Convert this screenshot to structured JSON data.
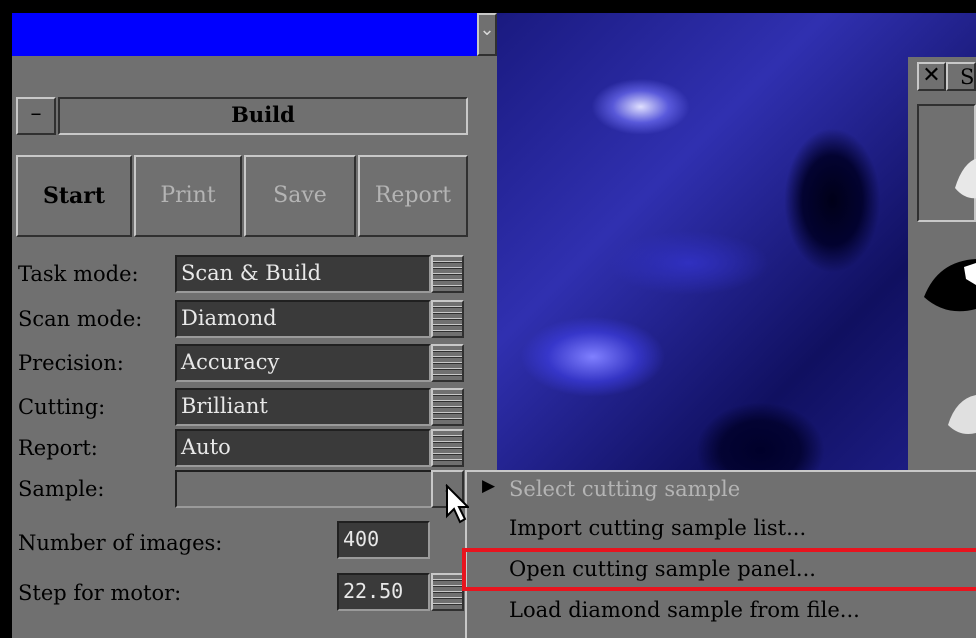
{
  "panel": {
    "section_title": "Build",
    "collapse_label": "–",
    "toolbar": [
      {
        "label": "Start",
        "enabled": true
      },
      {
        "label": "Print",
        "enabled": false
      },
      {
        "label": "Save",
        "enabled": false
      },
      {
        "label": "Report",
        "enabled": false
      }
    ],
    "settings": [
      {
        "label": "Task mode:",
        "value": "Scan & Build"
      },
      {
        "label": "Scan mode:",
        "value": "Diamond"
      },
      {
        "label": "Precision:",
        "value": "Accuracy"
      },
      {
        "label": "Cutting:",
        "value": "Brilliant"
      },
      {
        "label": "Report:",
        "value": "Auto"
      }
    ],
    "sample": {
      "label": "Sample:",
      "value": ""
    },
    "images": {
      "label": "Number of images:",
      "value": "400"
    },
    "motor": {
      "label": "Step for motor:",
      "value": "22.50"
    }
  },
  "side_window": {
    "title": "S",
    "close": "✕"
  },
  "context_menu": {
    "header": "Select cutting sample",
    "items": [
      "Import cutting sample list...",
      "Open cutting sample panel...",
      "Load diamond sample from file..."
    ],
    "highlighted_index": 1
  },
  "colors": {
    "titlebar": "#0000ff",
    "panel": "#707070",
    "highlight": "#e8141e"
  }
}
